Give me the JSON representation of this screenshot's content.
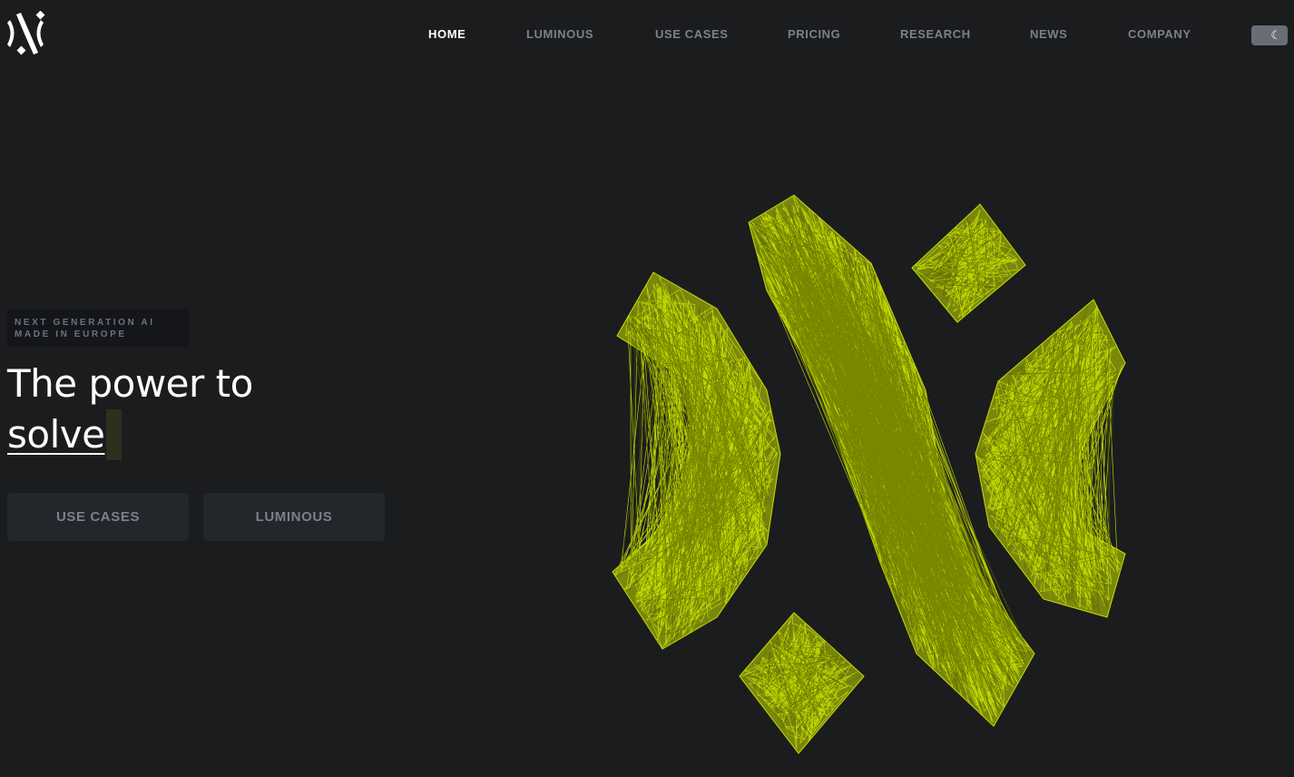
{
  "logo": {
    "icon": "brand-logo-icon"
  },
  "nav": {
    "items": [
      {
        "label": "HOME",
        "active": true
      },
      {
        "label": "LUMINOUS",
        "active": false
      },
      {
        "label": "USE CASES",
        "active": false
      },
      {
        "label": "PRICING",
        "active": false
      },
      {
        "label": "RESEARCH",
        "active": false
      },
      {
        "label": "NEWS",
        "active": false
      },
      {
        "label": "COMPANY",
        "active": false
      }
    ],
    "theme_toggle": {
      "icon": "moon-icon",
      "glyph": "☾"
    }
  },
  "hero": {
    "tag_line_1": "NEXT GENERATION AI",
    "tag_line_2": "MADE IN EUROPE",
    "headline_line_1": "The power to",
    "headline_word": "solve",
    "buttons": {
      "use_cases": "USE CASES",
      "luminous": "LUMINOUS"
    }
  },
  "colors": {
    "background": "#1b1c1e",
    "accent": "#c8e000",
    "nav_inactive": "#7d8088",
    "button_bg": "#23262b"
  }
}
